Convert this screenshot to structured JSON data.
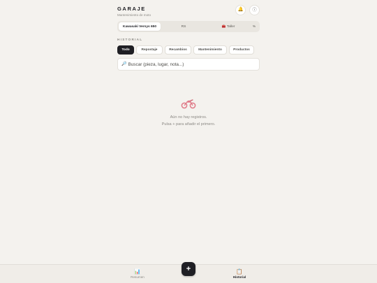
{
  "header": {
    "title": "GARAJE",
    "subtitle": "Mantenimiento de moto",
    "bell_icon": "bell-icon",
    "info_icon": "info-icon"
  },
  "segments": {
    "bike": "Kawasaki Versys 650",
    "rs": "RS",
    "taller_icon": "toolbox-icon",
    "taller": "Taller",
    "pct": "%"
  },
  "history": {
    "section_label": "HISTORIAL",
    "filters": [
      "Todo",
      "Repostaje",
      "Recambios",
      "Mantenimiento",
      "Productos"
    ],
    "active_filter": "Todo"
  },
  "search": {
    "placeholder": "Buscar (pieza, lugar, nota...)",
    "icon": "search-icon"
  },
  "empty_state": {
    "icon": "motorcycle-icon",
    "line1": "Aún no hay registros.",
    "line2": "Pulsa + para añadir el primero."
  },
  "bottom_nav": {
    "resumen_icon": "bar-chart-icon",
    "resumen_label": "Resumen",
    "add_label": "+",
    "historial_icon": "clipboard-icon",
    "historial_label": "Historial",
    "active": "Historial"
  },
  "colors": {
    "background": "#f4f2ee",
    "accent_dark": "#1f1f24",
    "muted_text": "#8b8984",
    "moto_icon": "#e07a88"
  }
}
